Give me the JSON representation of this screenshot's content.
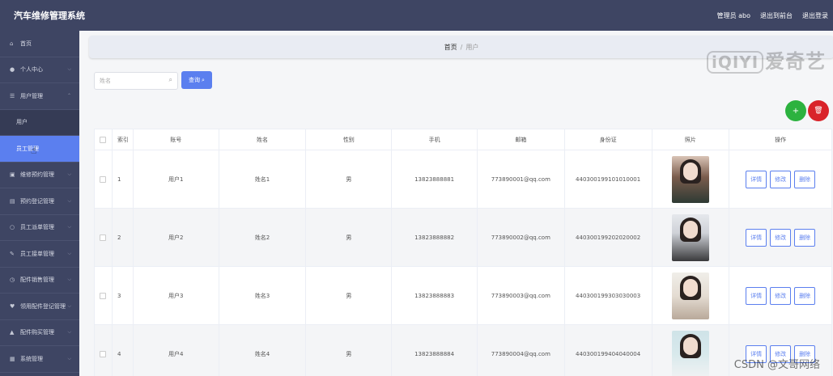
{
  "app": {
    "title": "汽车维修管理系统",
    "admin_label": "管理员 abo",
    "to_front": "退出到前台",
    "logout": "退出登录"
  },
  "sidebar": {
    "items": [
      {
        "label": "首页",
        "icon": "home-icon"
      },
      {
        "label": "个人中心",
        "icon": "user-icon"
      },
      {
        "label": "用户管理",
        "icon": "users-icon"
      },
      {
        "label": "用户",
        "sub": true
      },
      {
        "label": "员工管理",
        "sub": true,
        "active": true
      },
      {
        "label": "维修预约管理",
        "icon": "calendar-icon"
      },
      {
        "label": "预约登记管理",
        "icon": "clipboard-icon"
      },
      {
        "label": "员工派单管理",
        "icon": "dispatch-icon"
      },
      {
        "label": "员工接单管理",
        "icon": "receive-icon"
      },
      {
        "label": "配件销售管理",
        "icon": "sales-icon"
      },
      {
        "label": "领用配件登记管理",
        "icon": "parts-icon"
      },
      {
        "label": "配件购买管理",
        "icon": "purchase-icon"
      },
      {
        "label": "系统管理",
        "icon": "settings-icon"
      }
    ]
  },
  "breadcrumb": {
    "home": "首页",
    "sep": "/",
    "current": "用户"
  },
  "search": {
    "placeholder": "姓名",
    "button": "查询"
  },
  "watermark": {
    "logo": "iQIYI",
    "text": "爱奇艺"
  },
  "actions": {
    "add": "+",
    "delete": "🗑"
  },
  "table": {
    "columns": [
      "索引",
      "账号",
      "姓名",
      "性别",
      "手机",
      "邮箱",
      "身份证",
      "照片",
      "操作"
    ],
    "rows": [
      {
        "idx": "1",
        "account": "用户1",
        "name": "姓名1",
        "sex": "男",
        "phone": "13823888881",
        "email": "773890001@qq.com",
        "idcard": "440300199101010001"
      },
      {
        "idx": "2",
        "account": "用户2",
        "name": "姓名2",
        "sex": "男",
        "phone": "13823888882",
        "email": "773890002@qq.com",
        "idcard": "440300199202020002"
      },
      {
        "idx": "3",
        "account": "用户3",
        "name": "姓名3",
        "sex": "男",
        "phone": "13823888883",
        "email": "773890003@qq.com",
        "idcard": "440300199303030003"
      },
      {
        "idx": "4",
        "account": "用户4",
        "name": "姓名4",
        "sex": "男",
        "phone": "13823888884",
        "email": "773890004@qq.com",
        "idcard": "440300199404040004"
      }
    ],
    "op_detail": "详情",
    "op_edit": "修改",
    "op_delete": "删除"
  },
  "footer_watermark": "CSDN @文哥网络"
}
